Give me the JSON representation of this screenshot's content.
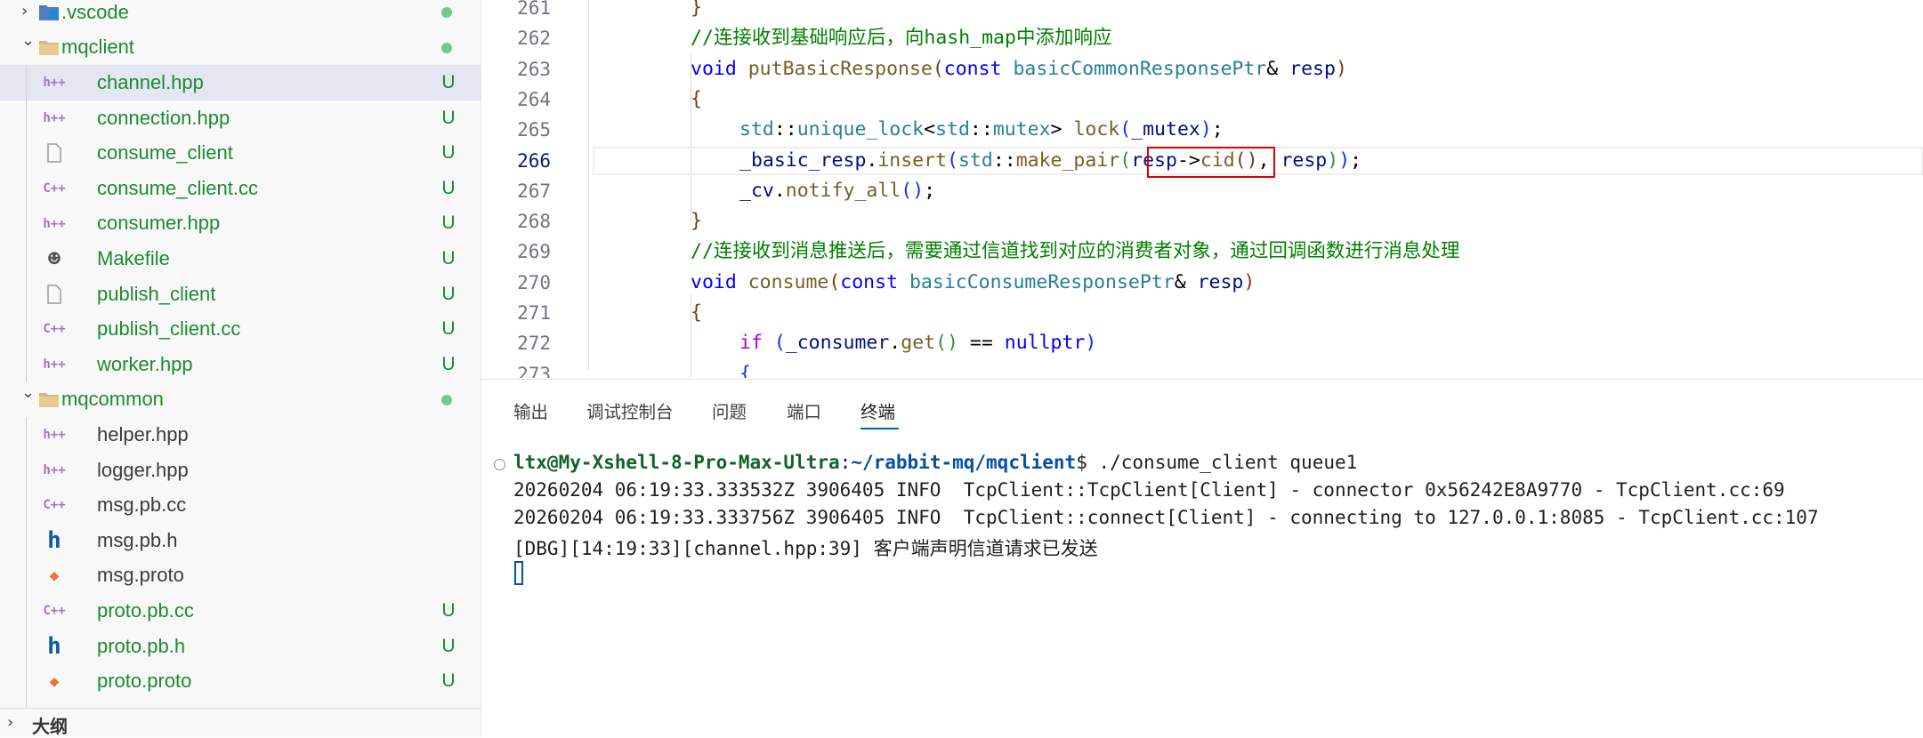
{
  "explorer": {
    "rows": [
      {
        "name": ".vscode",
        "kind": "folder-vscode",
        "status": "",
        "dot": true,
        "collapsed": true
      },
      {
        "name": "mqclient",
        "kind": "folder",
        "status": "",
        "dot": true,
        "collapsed": false
      },
      {
        "name": "channel.hpp",
        "kind": "hpp",
        "status": "U",
        "selected": true
      },
      {
        "name": "connection.hpp",
        "kind": "hpp",
        "status": "U"
      },
      {
        "name": "consume_client",
        "kind": "file",
        "status": "U"
      },
      {
        "name": "consume_client.cc",
        "kind": "cc",
        "status": "U"
      },
      {
        "name": "consumer.hpp",
        "kind": "hpp",
        "status": "U"
      },
      {
        "name": "Makefile",
        "kind": "makefile",
        "status": "U"
      },
      {
        "name": "publish_client",
        "kind": "file",
        "status": "U"
      },
      {
        "name": "publish_client.cc",
        "kind": "cc",
        "status": "U"
      },
      {
        "name": "worker.hpp",
        "kind": "hpp",
        "status": "U"
      },
      {
        "name": "mqcommon",
        "kind": "folder",
        "status": "",
        "dot": true,
        "collapsed": false
      },
      {
        "name": "helper.hpp",
        "kind": "hpp",
        "status": ""
      },
      {
        "name": "logger.hpp",
        "kind": "hpp",
        "status": ""
      },
      {
        "name": "msg.pb.cc",
        "kind": "cc",
        "status": ""
      },
      {
        "name": "msg.pb.h",
        "kind": "h",
        "status": ""
      },
      {
        "name": "msg.proto",
        "kind": "proto",
        "status": ""
      },
      {
        "name": "proto.pb.cc",
        "kind": "cc",
        "status": "U"
      },
      {
        "name": "proto.pb.h",
        "kind": "h",
        "status": "U"
      },
      {
        "name": "proto.proto",
        "kind": "proto",
        "status": "U"
      }
    ],
    "outline_label": "大纲"
  },
  "editor": {
    "active_line": 266,
    "lines": [
      {
        "n": "261",
        "segments": [
          {
            "t": "}",
            "c": "br3"
          }
        ]
      },
      {
        "n": "262",
        "segments": [
          {
            "t": "//连接收到基础响应后，向hash_map中添加响应",
            "c": "cm"
          }
        ]
      },
      {
        "n": "263",
        "segments": [
          {
            "t": "void",
            "c": "kw"
          },
          {
            "t": " ",
            "c": "op"
          },
          {
            "t": "putBasicResponse",
            "c": "fn"
          },
          {
            "t": "(",
            "c": "br3"
          },
          {
            "t": "const",
            "c": "kw"
          },
          {
            "t": " ",
            "c": "op"
          },
          {
            "t": "basicCommonResponsePtr",
            "c": "ty"
          },
          {
            "t": "& ",
            "c": "op"
          },
          {
            "t": "resp",
            "c": "var"
          },
          {
            "t": ")",
            "c": "br3"
          }
        ]
      },
      {
        "n": "264",
        "segments": [
          {
            "t": "{",
            "c": "br3"
          }
        ]
      },
      {
        "n": "265",
        "indent": 2,
        "segments": [
          {
            "t": "std",
            "c": "ty"
          },
          {
            "t": "::",
            "c": "op"
          },
          {
            "t": "unique_lock",
            "c": "ty"
          },
          {
            "t": "<",
            "c": "op"
          },
          {
            "t": "std",
            "c": "ty"
          },
          {
            "t": "::",
            "c": "op"
          },
          {
            "t": "mutex",
            "c": "ty"
          },
          {
            "t": "> ",
            "c": "op"
          },
          {
            "t": "lock",
            "c": "fn"
          },
          {
            "t": "(",
            "c": "br1"
          },
          {
            "t": "_mutex",
            "c": "var"
          },
          {
            "t": ")",
            "c": "br1"
          },
          {
            "t": ";",
            "c": "op"
          }
        ]
      },
      {
        "n": "266",
        "indent": 2,
        "segments": [
          {
            "t": "_basic_resp",
            "c": "var"
          },
          {
            "t": ".",
            "c": "op"
          },
          {
            "t": "insert",
            "c": "fn"
          },
          {
            "t": "(",
            "c": "br1"
          },
          {
            "t": "std",
            "c": "ty"
          },
          {
            "t": "::",
            "c": "op"
          },
          {
            "t": "make_pair",
            "c": "fn"
          },
          {
            "t": "(",
            "c": "br2"
          },
          {
            "t": "resp",
            "c": "var"
          },
          {
            "t": "->",
            "c": "op"
          },
          {
            "t": "cid",
            "c": "fn"
          },
          {
            "t": "()",
            "c": "br3"
          },
          {
            "t": ", ",
            "c": "op"
          },
          {
            "t": "resp",
            "c": "var"
          },
          {
            "t": ")",
            "c": "br2"
          },
          {
            "t": ")",
            "c": "br1"
          },
          {
            "t": ";",
            "c": "op"
          }
        ]
      },
      {
        "n": "267",
        "indent": 2,
        "segments": [
          {
            "t": "_cv",
            "c": "var"
          },
          {
            "t": ".",
            "c": "op"
          },
          {
            "t": "notify_all",
            "c": "fn"
          },
          {
            "t": "()",
            "c": "br1"
          },
          {
            "t": ";",
            "c": "op"
          }
        ]
      },
      {
        "n": "268",
        "segments": [
          {
            "t": "}",
            "c": "br3"
          }
        ]
      },
      {
        "n": "269",
        "segments": [
          {
            "t": "//连接收到消息推送后，需要通过信道找到对应的消费者对象，通过回调函数进行消息处理",
            "c": "cm"
          }
        ]
      },
      {
        "n": "270",
        "segments": [
          {
            "t": "void",
            "c": "kw"
          },
          {
            "t": " ",
            "c": "op"
          },
          {
            "t": "consume",
            "c": "fn"
          },
          {
            "t": "(",
            "c": "br3"
          },
          {
            "t": "const",
            "c": "kw"
          },
          {
            "t": " ",
            "c": "op"
          },
          {
            "t": "basicConsumeResponsePtr",
            "c": "ty"
          },
          {
            "t": "& ",
            "c": "op"
          },
          {
            "t": "resp",
            "c": "var"
          },
          {
            "t": ")",
            "c": "br3"
          }
        ]
      },
      {
        "n": "271",
        "segments": [
          {
            "t": "{",
            "c": "br3"
          }
        ]
      },
      {
        "n": "272",
        "indent": 2,
        "segments": [
          {
            "t": "if",
            "c": "ctl"
          },
          {
            "t": " ",
            "c": "op"
          },
          {
            "t": "(",
            "c": "br1"
          },
          {
            "t": "_consumer",
            "c": "var"
          },
          {
            "t": ".",
            "c": "op"
          },
          {
            "t": "get",
            "c": "fn"
          },
          {
            "t": "()",
            "c": "br2"
          },
          {
            "t": " == ",
            "c": "op"
          },
          {
            "t": "nullptr",
            "c": "kw"
          },
          {
            "t": ")",
            "c": "br1"
          }
        ]
      },
      {
        "n": "273",
        "indent": 2,
        "segments": [
          {
            "t": "{",
            "c": "br1"
          }
        ]
      }
    ]
  },
  "panel": {
    "tabs": [
      "输出",
      "调试控制台",
      "问题",
      "端口",
      "终端"
    ],
    "active_tab": "终端",
    "terminal": {
      "prompt_user": "ltx@My-Xshell-8-Pro-Max-Ultra",
      "prompt_sep": ":",
      "prompt_path": "~/rabbit-mq/mqclient",
      "prompt_end": "$ ",
      "command": "./consume_client queue1",
      "lines": [
        "20260204 06:19:33.333532Z 3906405 INFO  TcpClient::TcpClient[Client] - connector 0x56242E8A9770 - TcpClient.cc:69",
        "20260204 06:19:33.333756Z 3906405 INFO  TcpClient::connect[Client] - connecting to 127.0.0.1:8085 - TcpClient.cc:107",
        "[DBG][14:19:33][channel.hpp:39] 客户端声明信道请求已发送"
      ]
    }
  },
  "colors": {
    "git_untracked": "#1b8b34",
    "selection": "#e4e6f1",
    "highlight_box": "#e00000",
    "accent": "#005fb8"
  }
}
